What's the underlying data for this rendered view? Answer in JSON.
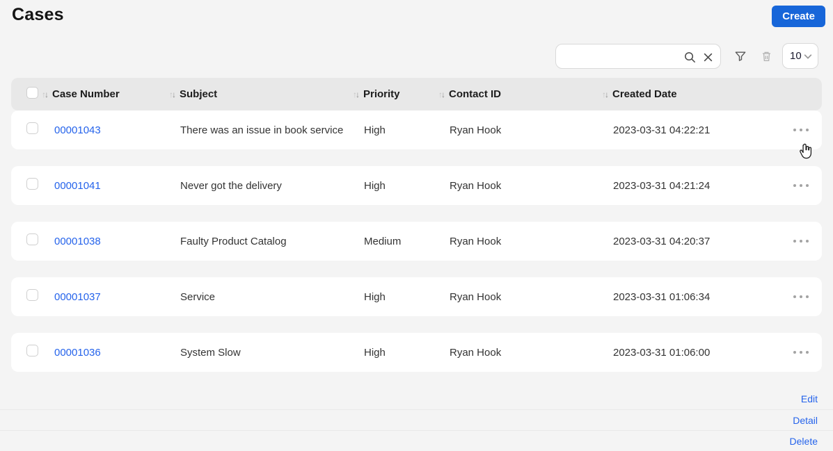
{
  "page": {
    "title": "Cases"
  },
  "colors": {
    "accent": "#1766d9",
    "link": "#2563eb",
    "header_bg": "#e8e8e8",
    "page_bg": "#f4f4f4",
    "row_bg": "#ffffff"
  },
  "toolbar": {
    "create_label": "Create",
    "search": {
      "value": "",
      "placeholder": ""
    },
    "page_size": {
      "value": "10"
    }
  },
  "table": {
    "columns": [
      {
        "key": "case_number",
        "label": "Case Number"
      },
      {
        "key": "subject",
        "label": "Subject"
      },
      {
        "key": "priority",
        "label": "Priority"
      },
      {
        "key": "contact_id",
        "label": "Contact ID"
      },
      {
        "key": "created_date",
        "label": "Created Date"
      }
    ],
    "rows": [
      {
        "case_number": "00001043",
        "subject": "There was an issue in book service",
        "priority": "High",
        "contact_id": "Ryan Hook",
        "created_date": "2023-03-31 04:22:21"
      },
      {
        "case_number": "00001041",
        "subject": "Never got the delivery",
        "priority": "High",
        "contact_id": "Ryan Hook",
        "created_date": "2023-03-31 04:21:24"
      },
      {
        "case_number": "00001038",
        "subject": "Faulty Product Catalog",
        "priority": "Medium",
        "contact_id": "Ryan Hook",
        "created_date": "2023-03-31 04:20:37"
      },
      {
        "case_number": "00001037",
        "subject": "Service",
        "priority": "High",
        "contact_id": "Ryan Hook",
        "created_date": "2023-03-31 01:06:34"
      },
      {
        "case_number": "00001036",
        "subject": "System Slow",
        "priority": "High",
        "contact_id": "Ryan Hook",
        "created_date": "2023-03-31 01:06:00"
      }
    ]
  },
  "row_menu": {
    "items": [
      {
        "label": "Edit"
      },
      {
        "label": "Detail"
      },
      {
        "label": "Delete"
      }
    ]
  }
}
